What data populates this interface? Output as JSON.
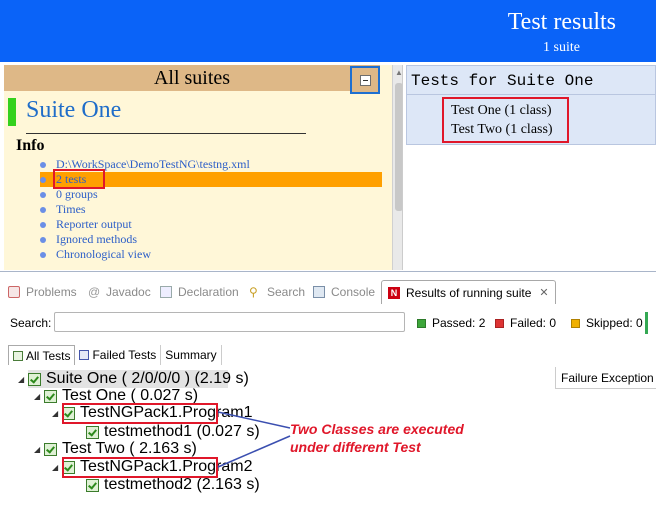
{
  "report": {
    "title": "Test results",
    "subtitle": "1 suite"
  },
  "left_panel": {
    "header": "All suites",
    "suite_name": "Suite One",
    "info_heading": "Info",
    "info_items": [
      "D:\\WorkSpace\\DemoTestNG\\testng.xml",
      "2 tests",
      "0 groups",
      "Times",
      "Reporter output",
      "Ignored methods",
      "Chronological view"
    ]
  },
  "right_panel": {
    "header": "Tests for Suite One",
    "tests": [
      "Test One (1 class)",
      "Test Two (1 class)"
    ]
  },
  "eclipse_tabs": [
    {
      "label": "Problems",
      "icon": "problems-icon"
    },
    {
      "label": "Javadoc",
      "icon": "javadoc-icon"
    },
    {
      "label": "Declaration",
      "icon": "declaration-icon"
    },
    {
      "label": "Search",
      "icon": "search-icon"
    },
    {
      "label": "Console",
      "icon": "console-icon"
    },
    {
      "label": "Results of running suite",
      "icon": "testng-icon",
      "active": true
    }
  ],
  "search": {
    "label": "Search:",
    "value": "",
    "passed": "Passed: 2",
    "failed": "Failed: 0",
    "skipped": "Skipped: 0"
  },
  "result_tabs": [
    "All Tests",
    "Failed Tests",
    "Summary"
  ],
  "failure_column": "Failure Exception",
  "tree": {
    "suite": "Suite One ( 2/0/0/0 ) (2.19 s)",
    "test_one": "Test One ( 0.027 s)",
    "class_one": "TestNGPack1.Program1",
    "method_one": "testmethod1  (0.027 s)",
    "test_two": "Test Two ( 2.163 s)",
    "class_two": "TestNGPack1.Program2",
    "method_two": "testmethod2  (2.163 s)"
  },
  "annotation": [
    "Two Classes are executed",
    "under different Test"
  ],
  "colors": {
    "banner": "#0a63f8",
    "highlight": "#ffa000",
    "callout": "#e0172a",
    "suite_bar": "#34d11d"
  }
}
